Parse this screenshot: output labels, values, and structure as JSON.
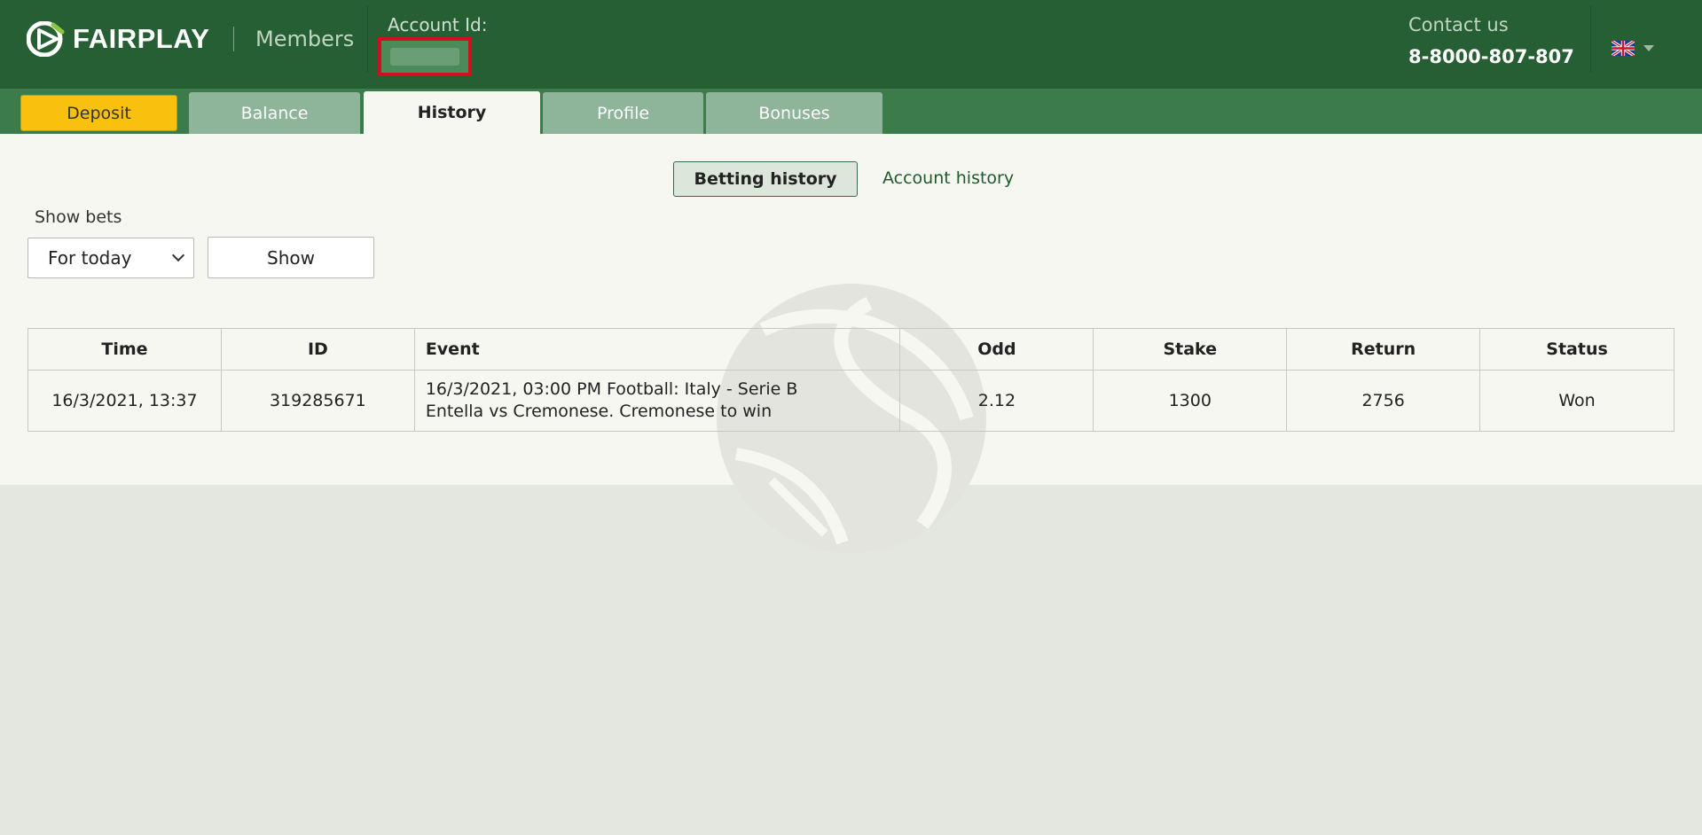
{
  "header": {
    "brand": "FAIRPLAY",
    "section": "Members",
    "account_label": "Account Id:",
    "contact_label": "Contact us",
    "contact_phone": "8-8000-807-807"
  },
  "tabs": [
    {
      "label": "Deposit"
    },
    {
      "label": "Balance"
    },
    {
      "label": "History",
      "active": true
    },
    {
      "label": "Profile"
    },
    {
      "label": "Bonuses"
    }
  ],
  "history": {
    "subtabs": [
      {
        "label": "Betting history",
        "active": true
      },
      {
        "label": "Account history"
      }
    ],
    "filter": {
      "label": "Show bets",
      "period": "For today",
      "show_button": "Show"
    },
    "table": {
      "columns": [
        "Time",
        "ID",
        "Event",
        "Odd",
        "Stake",
        "Return",
        "Status"
      ],
      "rows": [
        {
          "time": "16/3/2021, 13:37",
          "id": "319285671",
          "event_line1": "16/3/2021, 03:00 PM Football: Italy - Serie B",
          "event_line2": "Entella vs Cremonese. Cremonese to win",
          "odd": "2.12",
          "stake": "1300",
          "return": "2756",
          "status": "Won"
        }
      ]
    }
  },
  "colors": {
    "header_bg": "#265f33",
    "tab_active_bg": "#f7f7f2",
    "deposit_bg": "#f9c10e",
    "status_won": "#1e6fc7",
    "account_highlight": "#d0101d"
  }
}
